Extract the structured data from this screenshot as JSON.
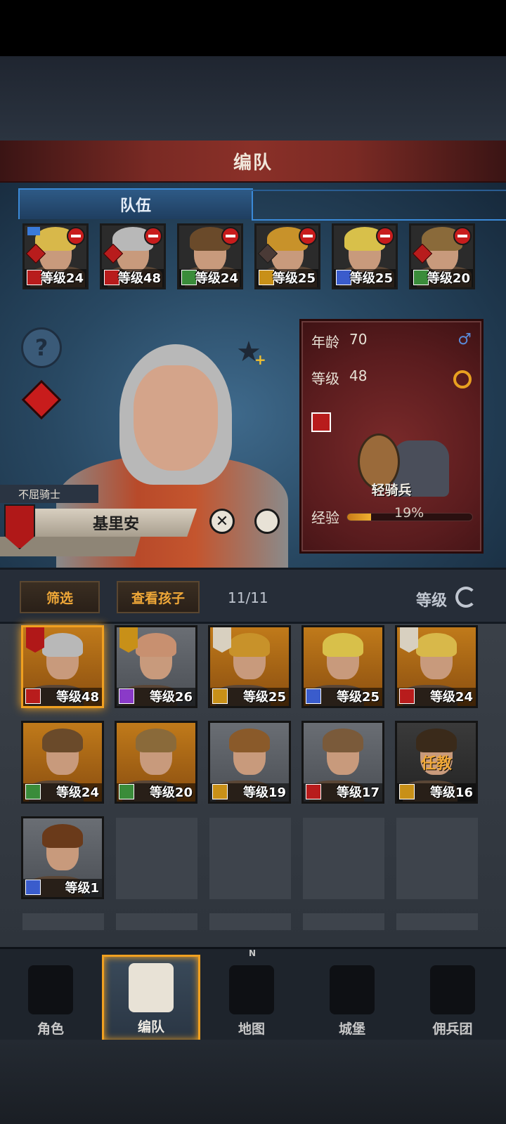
{
  "header": {
    "title": "编队"
  },
  "tabs": [
    {
      "label": "队伍"
    }
  ],
  "party": [
    {
      "level": "等级24",
      "class": "horse",
      "ci": "ci-red",
      "hair": "#d8b84a",
      "badge": "red",
      "flag": true
    },
    {
      "level": "等级48",
      "class": "horse",
      "ci": "ci-red",
      "hair": "#b8b8b8",
      "badge": "red",
      "flag": false
    },
    {
      "level": "等级24",
      "class": "archer",
      "ci": "ci-green",
      "hair": "#6a4a2a",
      "badge": "none",
      "flag": false
    },
    {
      "level": "等级25",
      "class": "shield",
      "ci": "ci-gold",
      "hair": "#c8922a",
      "badge": "dark",
      "flag": false
    },
    {
      "level": "等级25",
      "class": "sword",
      "ci": "ci-blue",
      "hair": "#d8c04a",
      "badge": "none",
      "flag": false
    },
    {
      "level": "等级20",
      "class": "archer",
      "ci": "ci-green",
      "hair": "#8a6a3a",
      "badge": "red",
      "flag": false
    }
  ],
  "hero": {
    "title": "不屈骑士",
    "name": "基里安",
    "age_label": "年龄",
    "age": "70",
    "level_label": "等级",
    "level": "48",
    "gender_symbol": "♂",
    "unit_type": "轻骑兵",
    "exp_label": "经验",
    "exp_percent": "19%",
    "exp_fraction": 0.19
  },
  "filter": {
    "filter_label": "筛选",
    "children_label": "查看孩子",
    "count": "11/11",
    "sort_label": "等级"
  },
  "roster": [
    {
      "level": "等级48",
      "ci": "ci-red",
      "card": "card-orange",
      "hair": "#b8b8b8",
      "banner": "red",
      "selected": true,
      "teach": ""
    },
    {
      "level": "等级26",
      "ci": "ci-purple",
      "card": "card-grey",
      "hair": "#c89070",
      "banner": "gold",
      "selected": false,
      "teach": ""
    },
    {
      "level": "等级25",
      "ci": "ci-gold",
      "card": "card-orange",
      "hair": "#c8922a",
      "banner": "top",
      "selected": false,
      "teach": ""
    },
    {
      "level": "等级25",
      "ci": "ci-blue",
      "card": "card-orange",
      "hair": "#d8c04a",
      "banner": "none",
      "selected": false,
      "teach": ""
    },
    {
      "level": "等级24",
      "ci": "ci-red",
      "card": "card-orange",
      "hair": "#d8b84a",
      "banner": "top",
      "selected": false,
      "teach": ""
    },
    {
      "level": "等级24",
      "ci": "ci-green",
      "card": "card-orange",
      "hair": "#6a4a2a",
      "banner": "none",
      "selected": false,
      "teach": ""
    },
    {
      "level": "等级20",
      "ci": "ci-green",
      "card": "card-orange",
      "hair": "#8a6a3a",
      "banner": "none",
      "selected": false,
      "teach": ""
    },
    {
      "level": "等级19",
      "ci": "ci-gold",
      "card": "card-grey",
      "hair": "#8a5a2a",
      "banner": "none",
      "selected": false,
      "teach": ""
    },
    {
      "level": "等级17",
      "ci": "ci-red",
      "card": "card-grey",
      "hair": "#7a5a3a",
      "banner": "none",
      "selected": false,
      "teach": ""
    },
    {
      "level": "等级16",
      "ci": "ci-gold",
      "card": "card-dark",
      "hair": "#3a2a1a",
      "banner": "none",
      "selected": false,
      "teach": "任教"
    },
    {
      "level": "等级1",
      "ci": "ci-blue",
      "card": "card-grey",
      "hair": "#6a3a1a",
      "banner": "none",
      "selected": false,
      "teach": ""
    }
  ],
  "nav": [
    {
      "label": "角色",
      "icon": "knight-icon"
    },
    {
      "label": "编队",
      "icon": "helmet-icon"
    },
    {
      "label": "地图",
      "icon": "compass-icon",
      "north": "N"
    },
    {
      "label": "城堡",
      "icon": "castle-icon"
    },
    {
      "label": "佣兵团",
      "icon": "mercenary-icon"
    }
  ],
  "colors": {
    "accent": "#f0a020",
    "tab_blue": "#3b8ad8",
    "title_red": "#7a2a24"
  }
}
